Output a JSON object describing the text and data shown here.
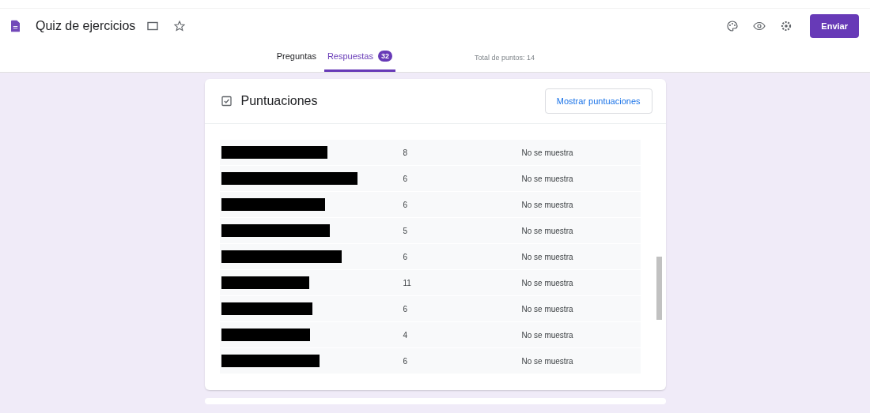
{
  "header": {
    "title": "Quiz de ejercicios",
    "send_button": "Enviar"
  },
  "tabs": [
    {
      "label": "Preguntas",
      "selected": false
    },
    {
      "label": "Respuestas",
      "selected": true,
      "badge": "32"
    }
  ],
  "total_points": "Total de puntos: 14",
  "scores_card": {
    "title": "Puntuaciones",
    "button": "Mostrar puntuaciones",
    "rows": [
      {
        "score": "8",
        "status": "No se muestra"
      },
      {
        "score": "6",
        "status": "No se muestra"
      },
      {
        "score": "6",
        "status": "No se muestra"
      },
      {
        "score": "5",
        "status": "No se muestra"
      },
      {
        "score": "6",
        "status": "No se muestra"
      },
      {
        "score": "11",
        "status": "No se muestra"
      },
      {
        "score": "6",
        "status": "No se muestra"
      },
      {
        "score": "4",
        "status": "No se muestra"
      },
      {
        "score": "6",
        "status": "No se muestra"
      }
    ]
  }
}
